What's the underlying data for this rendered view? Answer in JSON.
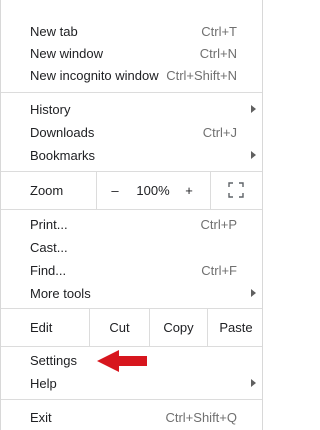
{
  "menu": {
    "group1": [
      {
        "label": "New tab",
        "shortcut": "Ctrl+T"
      },
      {
        "label": "New window",
        "shortcut": "Ctrl+N"
      },
      {
        "label": "New incognito window",
        "shortcut": "Ctrl+Shift+N"
      }
    ],
    "group2": [
      {
        "label": "History",
        "submenu": true
      },
      {
        "label": "Downloads",
        "shortcut": "Ctrl+J"
      },
      {
        "label": "Bookmarks",
        "submenu": true
      }
    ],
    "zoom": {
      "label": "Zoom",
      "minus": "–",
      "level": "100%",
      "plus": "+"
    },
    "group3": [
      {
        "label": "Print...",
        "shortcut": "Ctrl+P"
      },
      {
        "label": "Cast..."
      },
      {
        "label": "Find...",
        "shortcut": "Ctrl+F"
      },
      {
        "label": "More tools",
        "submenu": true
      }
    ],
    "edit": {
      "label": "Edit",
      "cut": "Cut",
      "copy": "Copy",
      "paste": "Paste"
    },
    "group4": [
      {
        "label": "Settings"
      },
      {
        "label": "Help",
        "submenu": true
      }
    ],
    "exit": {
      "label": "Exit",
      "shortcut": "Ctrl+Shift+Q"
    }
  },
  "colors": {
    "annotation_arrow": "#d7161e"
  }
}
